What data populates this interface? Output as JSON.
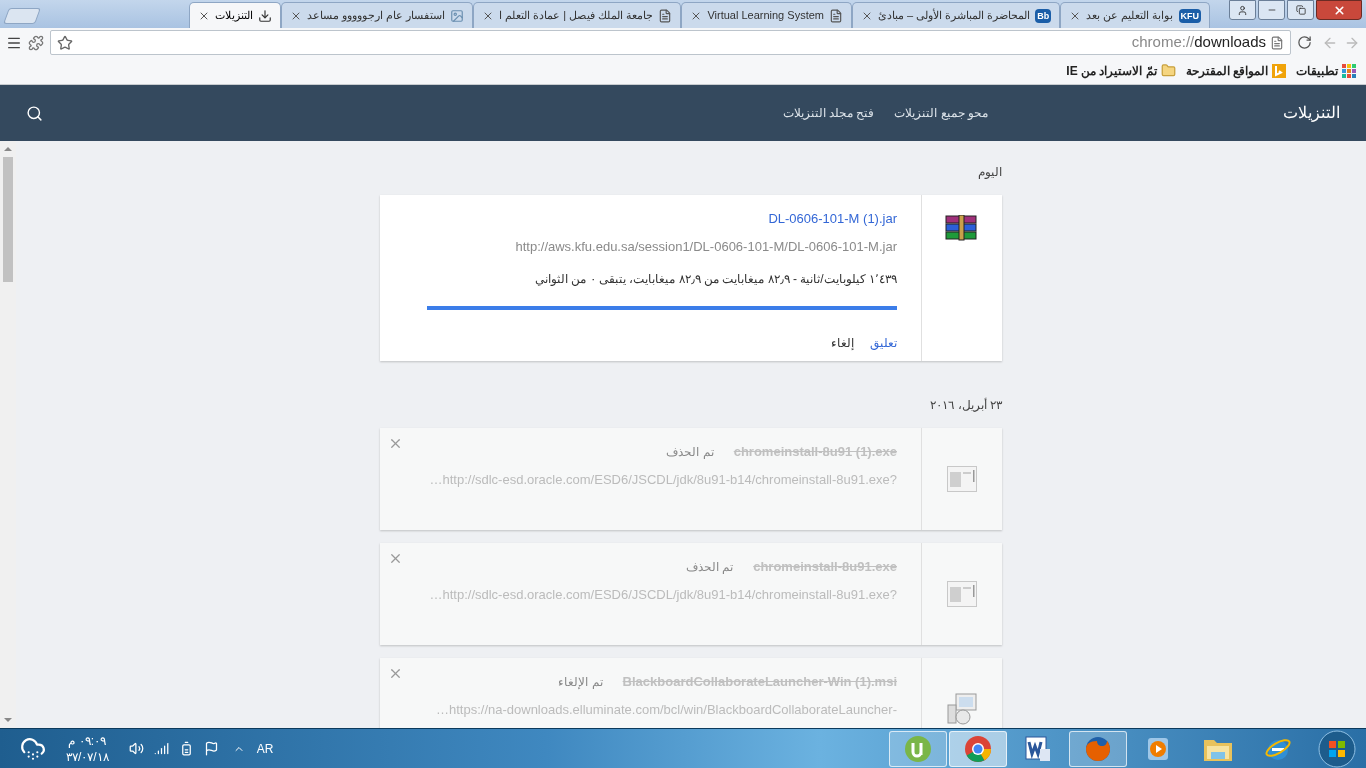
{
  "tabs": [
    {
      "title": "بوابة التعليم عن بعد",
      "kind": "badge",
      "badge": "KFU",
      "selected": false
    },
    {
      "title": "المحاضرة المباشرة الأولى – مبادئ",
      "kind": "badge",
      "badge": "Bb",
      "selected": false
    },
    {
      "title": "Virtual Learning System",
      "kind": "page",
      "selected": false
    },
    {
      "title": "جامعة الملك فيصل | عمادة التعلم ا",
      "kind": "page",
      "selected": false
    },
    {
      "title": "استفسار عام ارجووووو مساعد",
      "kind": "image",
      "selected": false
    },
    {
      "title": "التنزيلات",
      "kind": "download",
      "selected": true
    }
  ],
  "omnibox": {
    "scheme": "chrome://",
    "path": "downloads"
  },
  "bookmarks": [
    {
      "label": "تطبيقات",
      "kind": "apps"
    },
    {
      "label": "المواقع المقترحة",
      "kind": "bing"
    },
    {
      "label": "تمّ الاستيراد من IE",
      "kind": "folder"
    }
  ],
  "header": {
    "title": "التنزيلات",
    "links": [
      "محو جميع التنزيلات",
      "فتح مجلد التنزيلات"
    ]
  },
  "groups": [
    {
      "date": "اليوم",
      "items": [
        {
          "kind": "archive",
          "removed": false,
          "file_name": "DL-0606-101-M (1).jar",
          "url": "http://aws.kfu.edu.sa/session1/DL-0606-101-M/DL-0606-101-M.jar",
          "status": "١٬٤٣٩ كيلوبايت/ثانية - ٨٢٫٩ ميغابايت من ٨٢٫٩ ميغابايت، يتبقى ٠ من الثواني",
          "progress": {
            "level": 1
          },
          "actions": [
            {
              "label": "تعليق",
              "kind": "link"
            },
            {
              "label": "إلغاء",
              "kind": "plain"
            }
          ]
        }
      ]
    },
    {
      "date": "٢٣ أبريل، ٢٠١٦",
      "items": [
        {
          "kind": "program",
          "removed": true,
          "file_name": "chromeinstall-8u91 (1).exe",
          "status": "تم الحذف",
          "url": "…http://sdlc-esd.oracle.com/ESD6/JSCDL/jdk/8u91-b14/chromeinstall-8u91.exe?"
        },
        {
          "kind": "program",
          "removed": true,
          "file_name": "chromeinstall-8u91.exe",
          "status": "تم الحذف",
          "url": "…http://sdlc-esd.oracle.com/ESD6/JSCDL/jdk/8u91-b14/chromeinstall-8u91.exe?"
        },
        {
          "kind": "installer",
          "removed": true,
          "file_name": "BlackboardCollaborateLauncher-Win (1).msi",
          "status": "تم الإلغاء",
          "url": "…https://na-downloads.elluminate.com/bcl/win/BlackboardCollaborateLauncher-"
        }
      ]
    }
  ],
  "taskbar": {
    "time": "٠٩:٠٩ م",
    "date": "٣٧/٠٧/١٨",
    "language": "AR",
    "apps": [
      {
        "kind": "torrent",
        "running": true,
        "selected": false
      },
      {
        "kind": "round-browser",
        "running": true,
        "selected": true
      },
      {
        "kind": "document",
        "running": false,
        "selected": false
      },
      {
        "kind": "fox",
        "running": true,
        "selected": false
      },
      {
        "kind": "media",
        "running": false,
        "selected": false
      },
      {
        "kind": "folder",
        "running": false,
        "selected": false
      },
      {
        "kind": "globe",
        "running": false,
        "selected": false
      }
    ]
  }
}
